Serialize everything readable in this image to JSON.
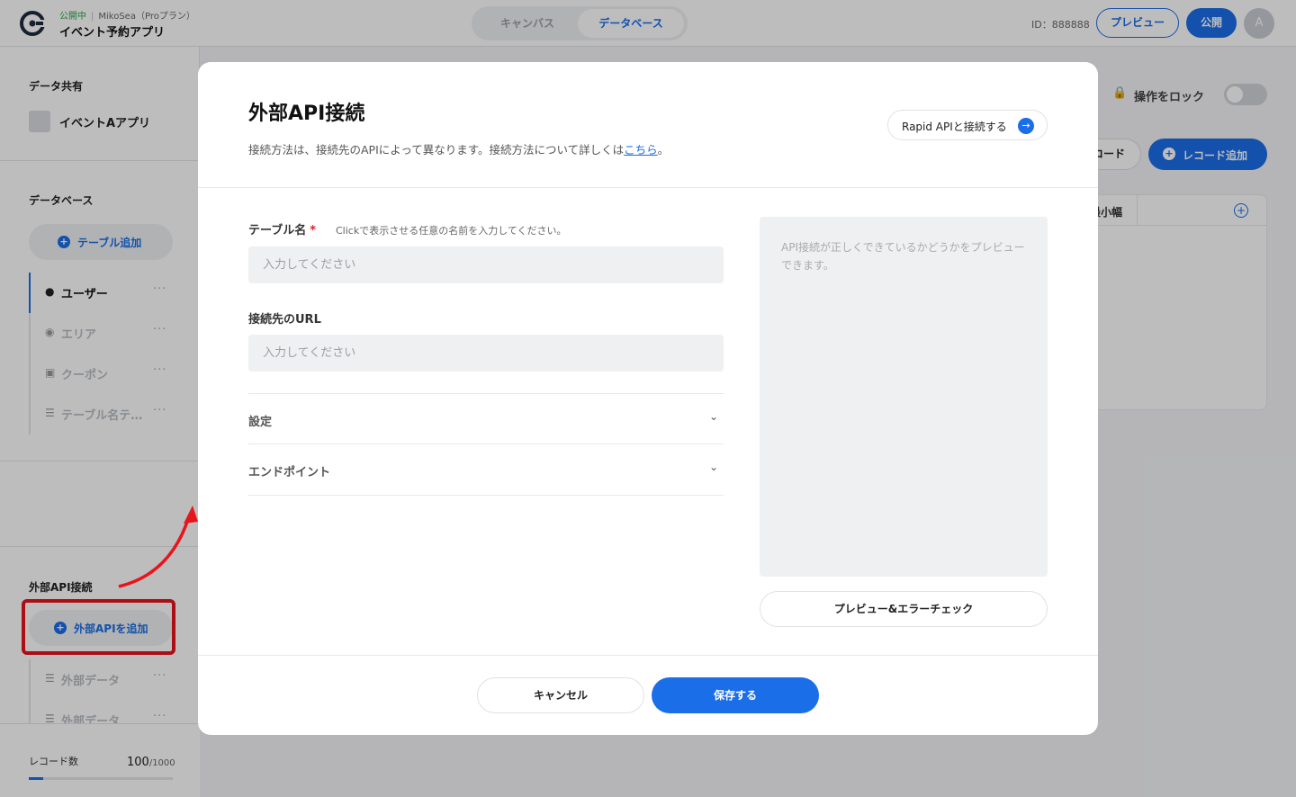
{
  "header": {
    "status": "公開中",
    "plan": "MikoSea（Proプラン）",
    "app_name": "イベント予約アプリ",
    "modes": [
      "キャンバス",
      "データベース"
    ],
    "active_mode": "データベース",
    "project_id": "ID：888888",
    "preview_label": "プレビュー",
    "publish_label": "公開",
    "avatar_initial": "A"
  },
  "sidebar": {
    "shared_heading": "データ共有",
    "shared_app": "イベントAアプリ",
    "db_heading": "データベース",
    "add_table_label": "テーブル追加",
    "tables": [
      {
        "label": "ユーザー",
        "icon": "user-icon",
        "active": true
      },
      {
        "label": "エリア",
        "icon": "location-icon",
        "active": false
      },
      {
        "label": "クーポン",
        "icon": "image-icon",
        "active": false
      },
      {
        "label": "テーブル名テ…",
        "icon": "database-icon",
        "active": false
      }
    ],
    "ext_heading": "外部API接続",
    "add_api_label": "外部APIを追加",
    "ext_tables": [
      {
        "label": "外部データ",
        "icon": "database-icon"
      },
      {
        "label": "外部データ",
        "icon": "database-icon"
      }
    ],
    "record_label": "レコード数",
    "record_count": "100",
    "record_max": "/1000",
    "record_fraction": 0.1
  },
  "main": {
    "lock_label": "操作をロック",
    "record_button_fragment": "コード",
    "add_record_label": "レコード追加",
    "column_fragment": "最小幅"
  },
  "modal": {
    "title": "外部API接続",
    "description_prefix": "接続方法は、接続先のAPIによって異なります。接続方法について詳しくは",
    "description_link": "こちら",
    "description_suffix": "。",
    "rapid_label": "Rapid APIと接続する",
    "table_name_label": "テーブル名",
    "required_mark": "*",
    "table_name_hint": "Clickで表示させる任意の名前を入力してください。",
    "table_name_placeholder": "入力してください",
    "url_label": "接続先のURL",
    "url_placeholder": "入力してください",
    "accordions": [
      "設定",
      "エンドポイント"
    ],
    "preview_text": "API接続が正しくできているかどうかをプレビューできます。",
    "preview_button": "プレビュー&エラーチェック",
    "cancel_label": "キャンセル",
    "save_label": "保存する"
  },
  "colors": {
    "accent": "#1a6ee8",
    "published": "#2aa64a",
    "highlight": "#e8141c",
    "required": "#e0202a"
  }
}
